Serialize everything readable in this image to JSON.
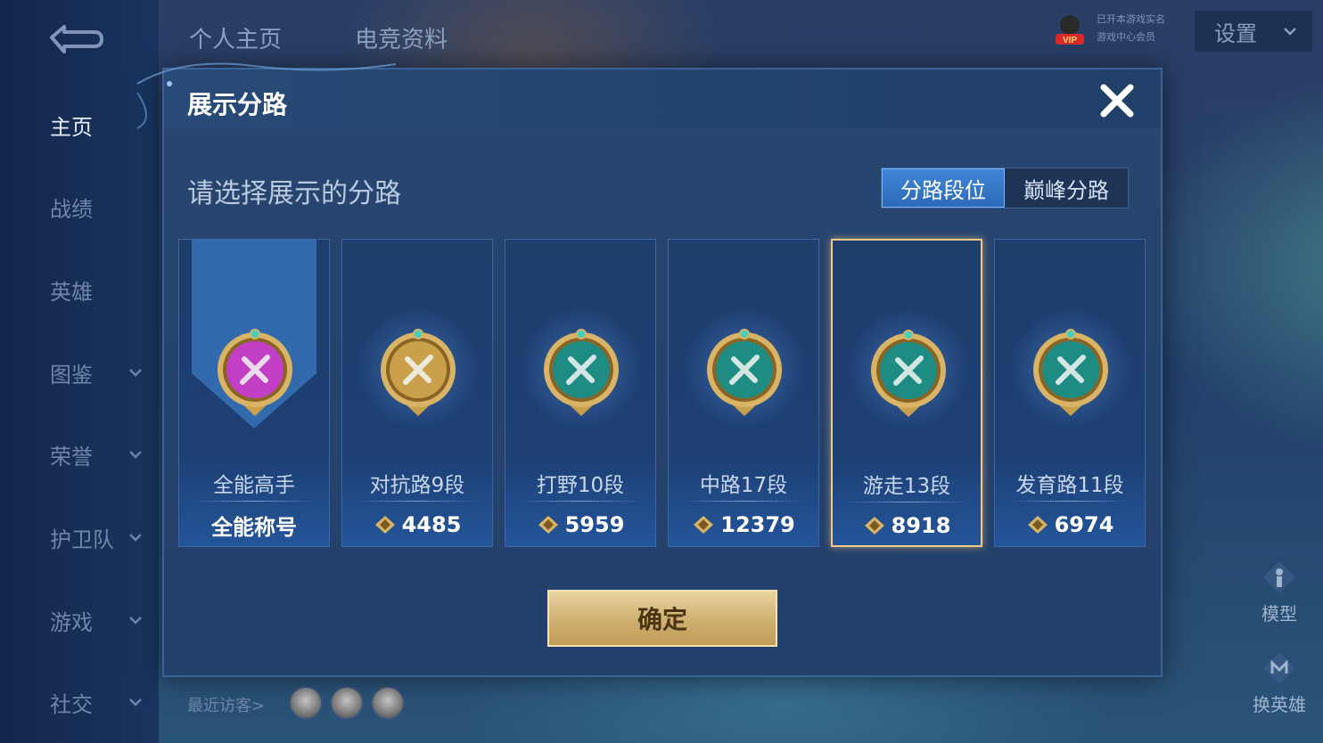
{
  "sidebar": {
    "items": [
      {
        "label": "主页",
        "active": true,
        "has_chevron": false
      },
      {
        "label": "战绩",
        "active": false,
        "has_chevron": false
      },
      {
        "label": "英雄",
        "active": false,
        "has_chevron": false
      },
      {
        "label": "图鉴",
        "active": false,
        "has_chevron": true
      },
      {
        "label": "荣誉",
        "active": false,
        "has_chevron": true
      },
      {
        "label": "护卫队",
        "active": false,
        "has_chevron": true
      },
      {
        "label": "游戏",
        "active": false,
        "has_chevron": true
      },
      {
        "label": "社交",
        "active": false,
        "has_chevron": true
      }
    ]
  },
  "topbar": {
    "tabs": [
      "个人主页",
      "电竞资料"
    ],
    "vip_badge": "VIP",
    "vip_lines": [
      "已开本游戏实名",
      "游戏中心会员"
    ],
    "settings_label": "设置"
  },
  "right_tools": {
    "model_label": "模型",
    "switch_hero_label": "换英雄"
  },
  "visitors": {
    "label": "最近访客>"
  },
  "dialog": {
    "title": "展示分路",
    "subtitle": "请选择展示的分路",
    "toggle": {
      "options": [
        "分路段位",
        "巅峰分路"
      ],
      "selected": "分路段位"
    },
    "cards": [
      {
        "name": "全能高手",
        "score": "全能称号",
        "badge_color": "#c23fc6",
        "icon": "all-round-emblem-icon",
        "selected": false,
        "has_points_icon": false
      },
      {
        "name": "对抗路9段",
        "score": "4485",
        "badge_color": "#caa04a",
        "icon": "clash-lane-emblem-icon",
        "selected": false,
        "has_points_icon": true
      },
      {
        "name": "打野10段",
        "score": "5959",
        "badge_color": "#1f8c84",
        "icon": "jungle-emblem-icon",
        "selected": false,
        "has_points_icon": true
      },
      {
        "name": "中路17段",
        "score": "12379",
        "badge_color": "#1f8c84",
        "icon": "mid-lane-emblem-icon",
        "selected": false,
        "has_points_icon": true
      },
      {
        "name": "游走13段",
        "score": "8918",
        "badge_color": "#1f8c84",
        "icon": "roam-emblem-icon",
        "selected": true,
        "has_points_icon": true
      },
      {
        "name": "发育路11段",
        "score": "6974",
        "badge_color": "#1f8c84",
        "icon": "farm-lane-emblem-icon",
        "selected": false,
        "has_points_icon": true
      }
    ],
    "confirm_label": "确定"
  }
}
